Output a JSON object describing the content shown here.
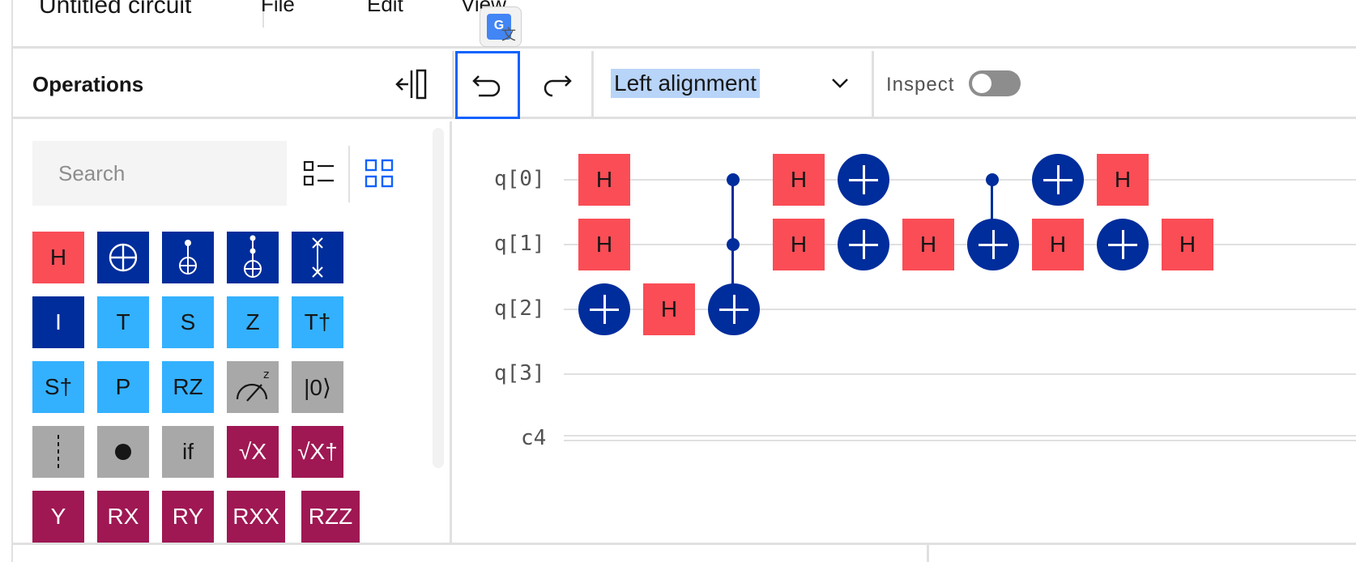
{
  "app": {
    "circuit_title": "Untitled circuit",
    "menu": [
      "File",
      "Edit",
      "View"
    ]
  },
  "toolbar": {
    "operations_title": "Operations",
    "alignment_value": "Left alignment",
    "inspect_label": "Inspect",
    "inspect_on": false
  },
  "ops_panel": {
    "search_placeholder": "Search",
    "gates": [
      [
        "H",
        "cnot",
        "toffoli",
        "ccx",
        "swap"
      ],
      [
        "I",
        "T",
        "S",
        "Z",
        "T†"
      ],
      [
        "S†",
        "P",
        "RZ",
        "measure",
        "|0⟩"
      ],
      [
        "barrier",
        "control",
        "if",
        "√X",
        "√X†"
      ],
      [
        "Y",
        "RX",
        "RY",
        "RXX",
        "RZZ"
      ]
    ],
    "gate_texts": {
      "h": "H",
      "i": "I",
      "t": "T",
      "s": "S",
      "z": "Z",
      "tdg": "T†",
      "sdg": "S†",
      "p": "P",
      "rz": "RZ",
      "reset": "|0⟩",
      "if": "if",
      "sx": "√X",
      "sxdg": "√X†",
      "y": "Y",
      "rx": "RX",
      "ry": "RY",
      "rxx": "RXX",
      "rzz": "RZZ"
    },
    "colors": {
      "red": "#fa4d56",
      "navy": "#002d9c",
      "cyan": "#33b1ff",
      "gray": "#a8a8a8",
      "magenta": "#9f1853"
    }
  },
  "circuit": {
    "qubits": [
      "q[0]",
      "q[1]",
      "q[2]",
      "q[3]"
    ],
    "classical": "c4",
    "gate_label": "H"
  }
}
